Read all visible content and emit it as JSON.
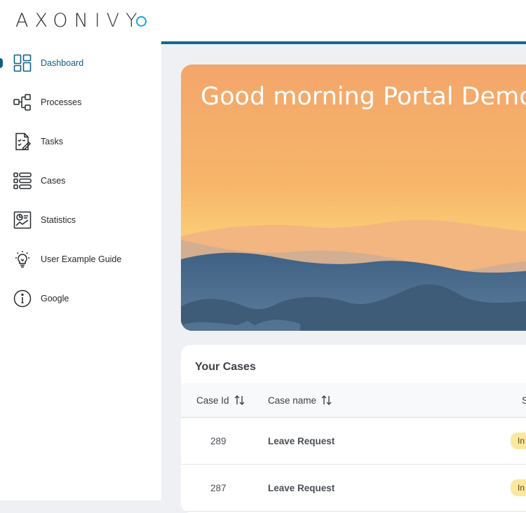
{
  "logo": {
    "text_main": "AXON",
    "text_thin": "IVY"
  },
  "sidebar": {
    "items": [
      {
        "label": "Dashboard",
        "icon": "dashboard-icon",
        "active": true
      },
      {
        "label": "Processes",
        "icon": "processes-icon"
      },
      {
        "label": "Tasks",
        "icon": "tasks-icon"
      },
      {
        "label": "Cases",
        "icon": "cases-icon"
      },
      {
        "label": "Statistics",
        "icon": "statistics-icon"
      },
      {
        "label": "User Example Guide",
        "icon": "lightbulb-icon"
      },
      {
        "label": "Google",
        "icon": "info-icon"
      }
    ]
  },
  "banner": {
    "greeting": "Good morning Portal Demo U"
  },
  "cases": {
    "title": "Your Cases",
    "columns": [
      "Case Id",
      "Case name",
      "S"
    ],
    "rows": [
      {
        "id": "289",
        "name": "Leave Request",
        "state": "In"
      },
      {
        "id": "287",
        "name": "Leave Request",
        "state": "In"
      }
    ]
  },
  "colors": {
    "accent": "#0d5f86",
    "topbar_border": "#0e6a8f",
    "logo_ring": "#18a7d6",
    "badge_bg": "#fbe7a0"
  }
}
